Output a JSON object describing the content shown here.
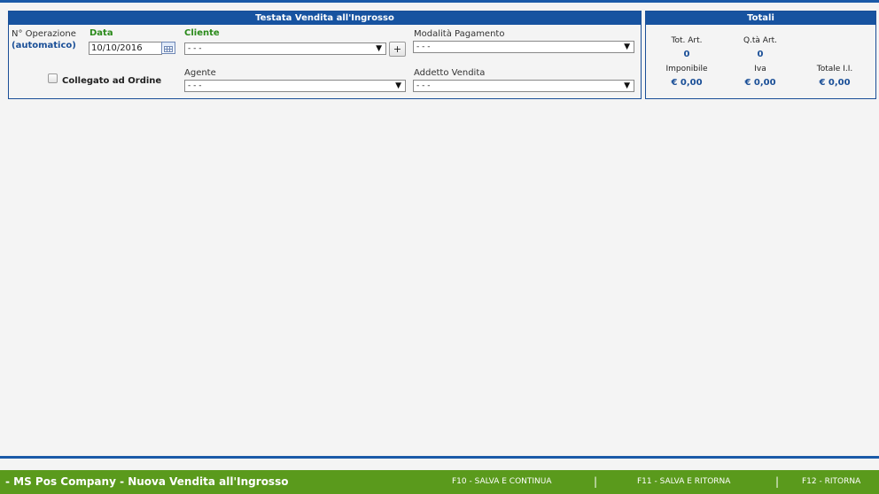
{
  "testata": {
    "title": "Testata Vendita all'Ingrosso",
    "operazione_label": "N° Operazione",
    "operazione_value": "(automatico)",
    "data_label": "Data",
    "data_value": "10/10/2016",
    "cliente_label": "Cliente",
    "cliente_value": "- - -",
    "plus_label": "+",
    "modalita_label": "Modalità Pagamento",
    "modalita_value": "- - -",
    "collegato_label": "Collegato ad Ordine",
    "agente_label": "Agente",
    "agente_value": "- - -",
    "addetto_label": "Addetto Vendita",
    "addetto_value": "- - -"
  },
  "totali": {
    "title": "Totali",
    "tot_art_label": "Tot. Art.",
    "tot_art_value": "0",
    "qta_art_label": "Q.tà Art.",
    "qta_art_value": "0",
    "imponibile_label": "Imponibile",
    "imponibile_value": "€ 0,00",
    "iva_label": "Iva",
    "iva_value": "€ 0,00",
    "totale_label": "Totale I.I.",
    "totale_value": "€ 0,00"
  },
  "footer": {
    "title": "- MS Pos Company - Nuova Vendita all'Ingrosso",
    "f10": "F10 - SALVA E CONTINUA",
    "f11": "F11 - SALVA E RITORNA",
    "f12": "F12 - RITORNA",
    "separator": "|"
  },
  "icons": {
    "dropdown": "triangle-down",
    "calendar": "calendar-icon"
  },
  "colors": {
    "panel_header": "#1753a0",
    "label_green": "#2a8a1a",
    "value_blue": "#1a4f97",
    "footer_bg": "#5a9a1c"
  }
}
